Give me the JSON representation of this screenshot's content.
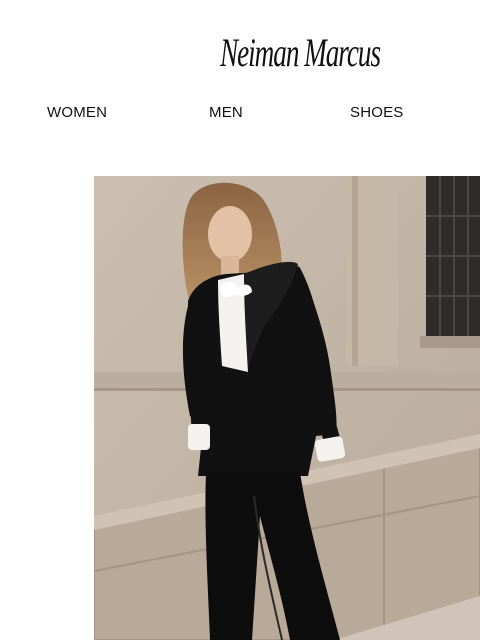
{
  "brand": {
    "logo_text": "Neiman Marcus"
  },
  "nav": {
    "items": [
      {
        "label": "WOMEN"
      },
      {
        "label": "MEN"
      },
      {
        "label": "SHOES"
      }
    ]
  },
  "colors": {
    "background": "#ffffff",
    "text": "#111111",
    "hero_wall": "#c9bcae",
    "suit": "#111111",
    "shirt": "#f4f2ef"
  }
}
